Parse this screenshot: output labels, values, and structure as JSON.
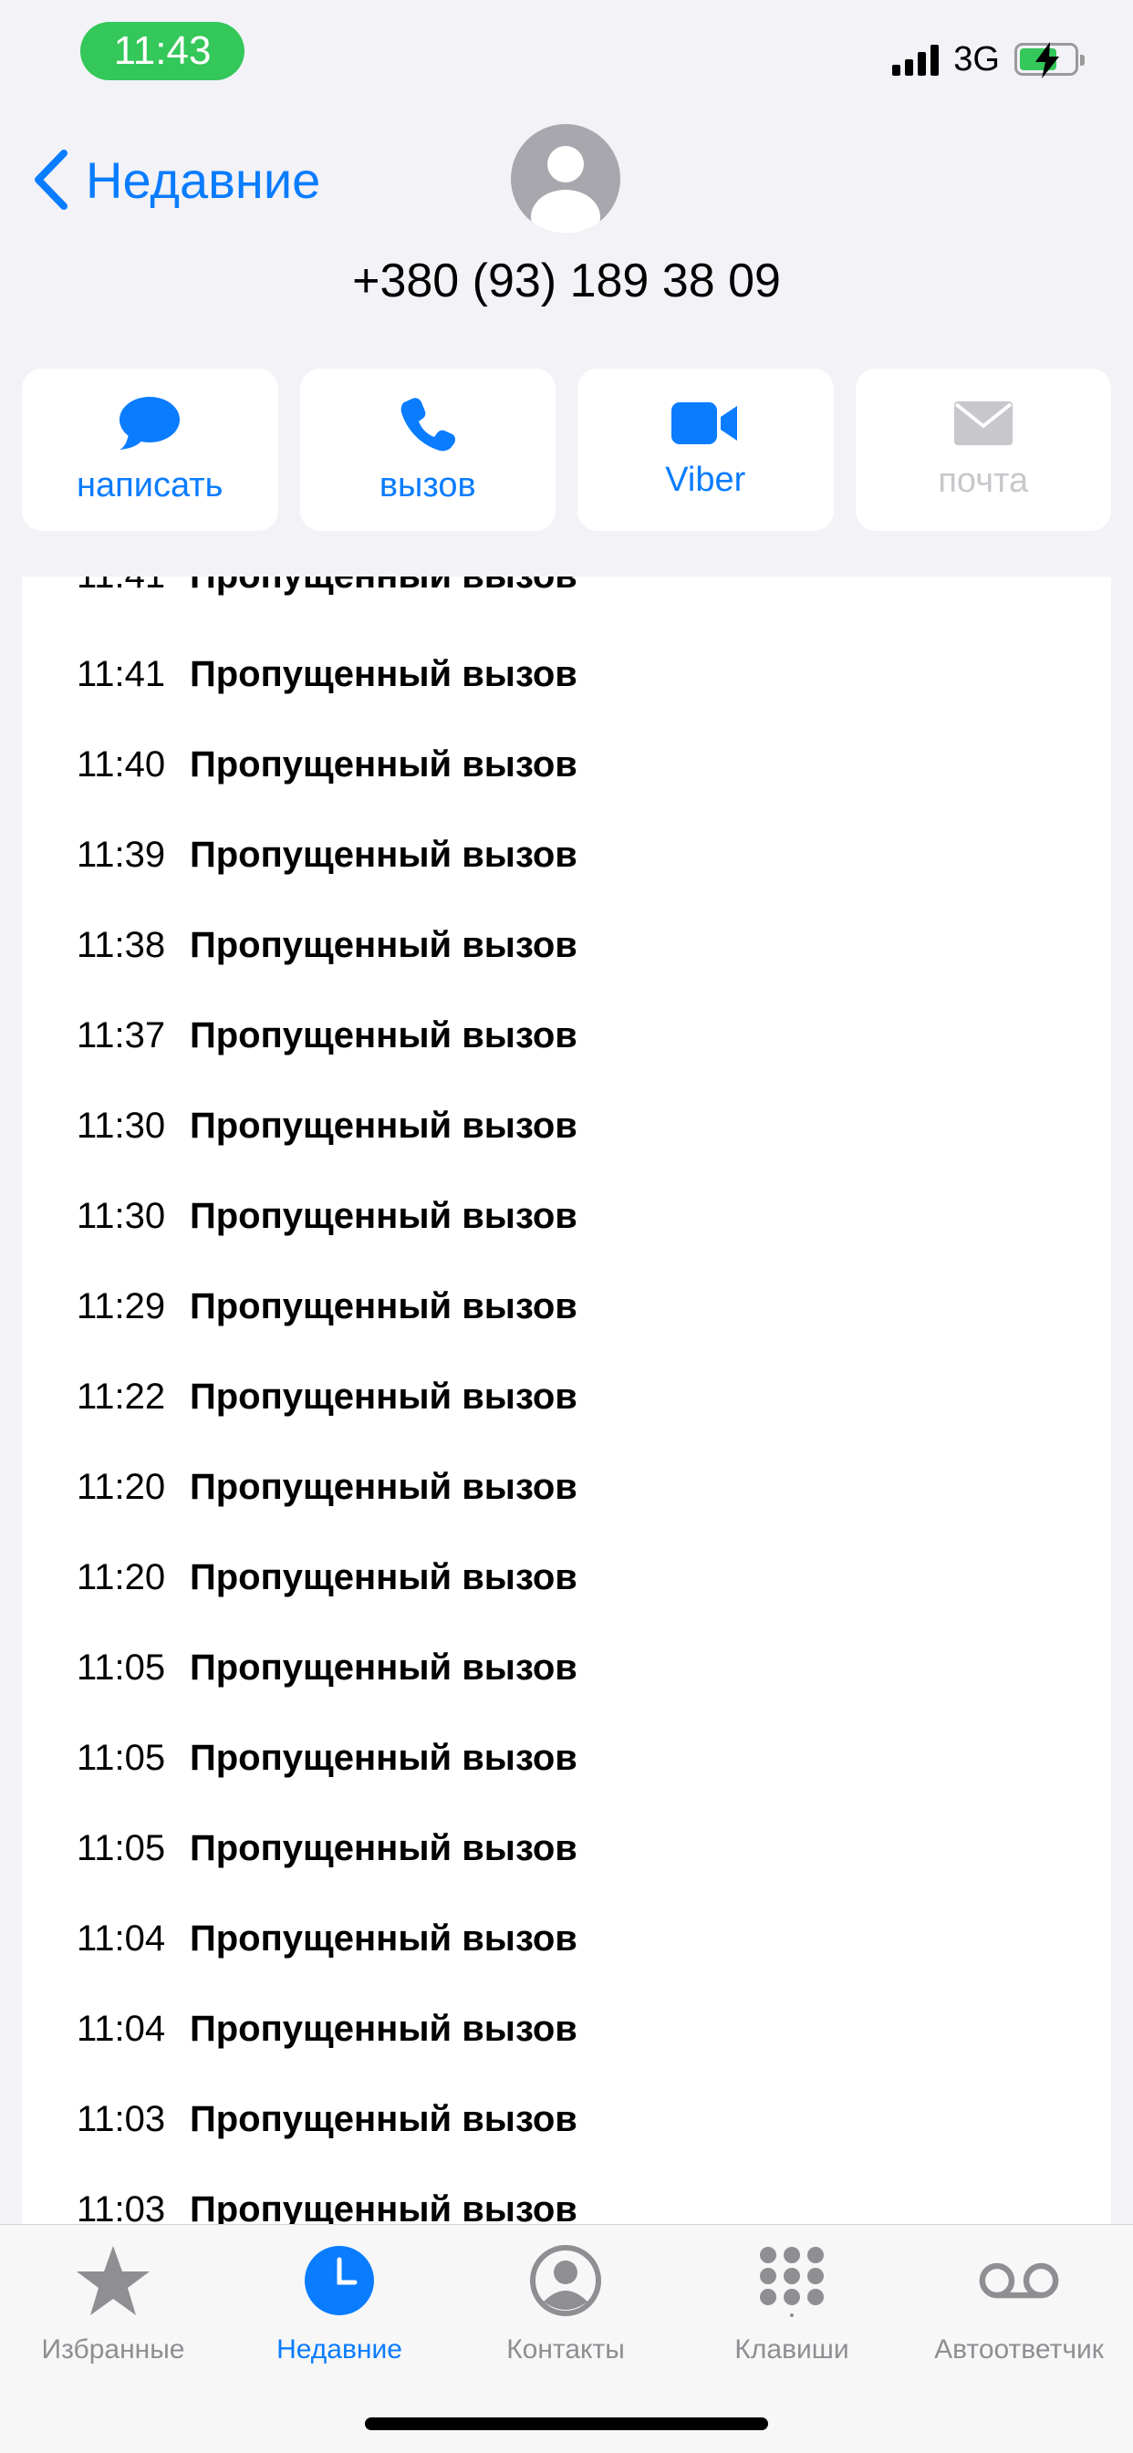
{
  "status_bar": {
    "time": "11:43",
    "network": "3G"
  },
  "nav": {
    "back_label": "Недавние",
    "phone_number": "+380 (93) 189 38 09"
  },
  "actions": [
    {
      "label": "написать",
      "icon": "message-bubble-icon",
      "enabled": true
    },
    {
      "label": "вызов",
      "icon": "phone-icon",
      "enabled": true
    },
    {
      "label": "Viber",
      "icon": "video-camera-icon",
      "enabled": true
    },
    {
      "label": "почта",
      "icon": "envelope-icon",
      "enabled": false
    }
  ],
  "calls": [
    {
      "time": "11:41",
      "status": "Пропущенный вызов"
    },
    {
      "time": "11:41",
      "status": "Пропущенный вызов"
    },
    {
      "time": "11:40",
      "status": "Пропущенный вызов"
    },
    {
      "time": "11:39",
      "status": "Пропущенный вызов"
    },
    {
      "time": "11:38",
      "status": "Пропущенный вызов"
    },
    {
      "time": "11:37",
      "status": "Пропущенный вызов"
    },
    {
      "time": "11:30",
      "status": "Пропущенный вызов"
    },
    {
      "time": "11:30",
      "status": "Пропущенный вызов"
    },
    {
      "time": "11:29",
      "status": "Пропущенный вызов"
    },
    {
      "time": "11:22",
      "status": "Пропущенный вызов"
    },
    {
      "time": "11:20",
      "status": "Пропущенный вызов"
    },
    {
      "time": "11:20",
      "status": "Пропущенный вызов"
    },
    {
      "time": "11:05",
      "status": "Пропущенный вызов"
    },
    {
      "time": "11:05",
      "status": "Пропущенный вызов"
    },
    {
      "time": "11:05",
      "status": "Пропущенный вызов"
    },
    {
      "time": "11:04",
      "status": "Пропущенный вызов"
    },
    {
      "time": "11:04",
      "status": "Пропущенный вызов"
    },
    {
      "time": "11:03",
      "status": "Пропущенный вызов"
    },
    {
      "time": "11:03",
      "status": "Пропущенный вызов"
    }
  ],
  "tabs": [
    {
      "label": "Избранные",
      "icon": "star-icon",
      "active": false
    },
    {
      "label": "Недавние",
      "icon": "clock-icon",
      "active": true
    },
    {
      "label": "Контакты",
      "icon": "person-circle-icon",
      "active": false
    },
    {
      "label": "Клавиши",
      "icon": "keypad-icon",
      "active": false
    },
    {
      "label": "Автоответчик",
      "icon": "voicemail-icon",
      "active": false
    }
  ],
  "colors": {
    "accent": "#0a7cff",
    "status_pill": "#34c759",
    "disabled": "#c7c7cc",
    "inactive_tab": "#8e8e93"
  }
}
